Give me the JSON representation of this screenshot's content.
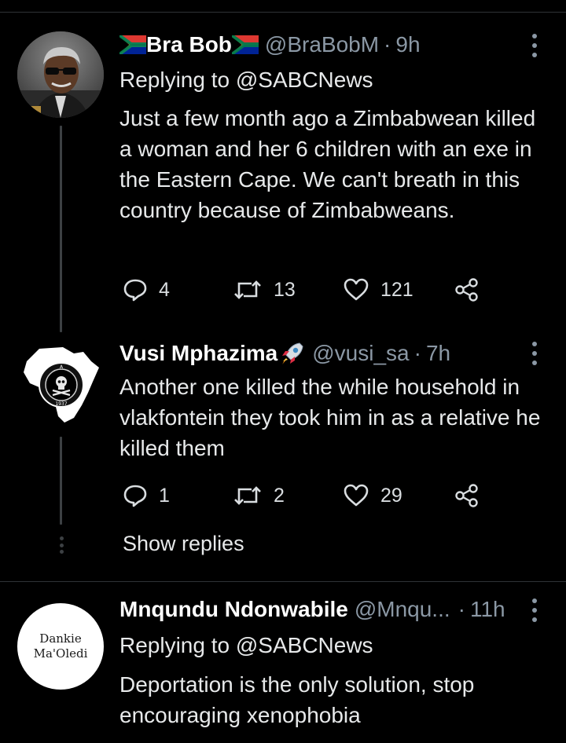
{
  "tweets": [
    {
      "display_name": "Bra Bob",
      "handle": "@BraBobM",
      "separator": "·",
      "time": "9h",
      "replying_to": "Replying to @SABCNews",
      "text": "Just a few month ago a Zimbabwean killed a woman and her 6 children with an exe in the Eastern Cape. We can't breath in this country because of Zimbabweans.",
      "replies": "4",
      "retweets": "13",
      "likes": "121",
      "avatar_icon": "person-with-sunglasses-avatar"
    },
    {
      "display_name": "Vusi Mphazima",
      "handle": "@vusi_sa",
      "separator": "·",
      "time": "7h",
      "text": "Another one killed the while household in vlakfontein they took him in as a relative he killed them",
      "replies": "1",
      "retweets": "2",
      "likes": "29",
      "avatar_icon": "africa-map-club-badge-avatar",
      "badge_year": "1937",
      "badge_letter": "A"
    },
    {
      "display_name": "Mnqundu Ndonwabile",
      "handle": "@Mnqu...",
      "separator": "·",
      "time": "11h",
      "replying_to": "Replying to @SABCNews",
      "text": "Deportation is the only solution, stop encouraging xenophobia",
      "avatar_line1": "Dankie",
      "avatar_line2": "Ma'Oledi"
    }
  ],
  "show_replies": "Show replies",
  "colors": {
    "background": "#000000",
    "text": "#e7e9ea",
    "secondary": "#8b98a5",
    "divider": "#2f3336",
    "thread_line": "#3c4043"
  }
}
